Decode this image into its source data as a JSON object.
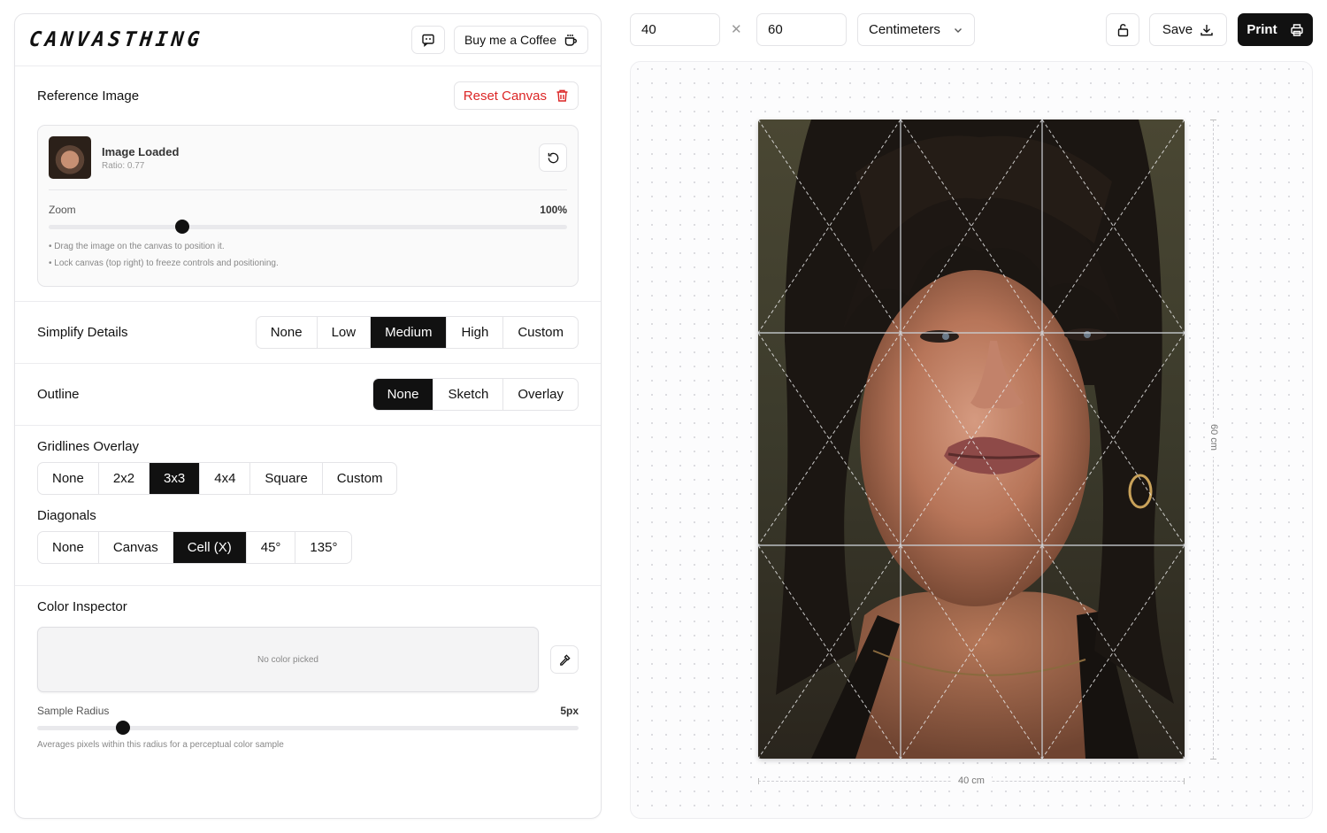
{
  "app": {
    "logo": "CANVASTHING",
    "coffee_label": "Buy me a Coffee"
  },
  "reference": {
    "title": "Reference Image",
    "reset_label": "Reset Canvas",
    "status": "Image Loaded",
    "ratio": "Ratio: 0.77",
    "zoom_label": "Zoom",
    "zoom_value": "100%",
    "zoom_level": 0.25,
    "hint_1": "• Drag the image on the canvas to position it.",
    "hint_2": "• Lock canvas (top right) to freeze controls and positioning."
  },
  "simplify": {
    "label": "Simplify Details",
    "options": [
      "None",
      "Low",
      "Medium",
      "High",
      "Custom"
    ],
    "selected": "Medium"
  },
  "outline": {
    "label": "Outline",
    "options": [
      "None",
      "Sketch",
      "Overlay"
    ],
    "selected": "None"
  },
  "gridlines": {
    "label": "Gridlines Overlay",
    "options": [
      "None",
      "2x2",
      "3x3",
      "4x4",
      "Square",
      "Custom"
    ],
    "selected": "3x3"
  },
  "diagonals": {
    "label": "Diagonals",
    "options": [
      "None",
      "Canvas",
      "Cell (X)",
      "45°",
      "135°"
    ],
    "selected": "Cell (X)"
  },
  "color_inspector": {
    "label": "Color Inspector",
    "empty_text": "No color picked",
    "radius_label": "Sample Radius",
    "radius_value": "5px",
    "radius_level": 0.15,
    "note": "Averages pixels within this radius for a perceptual color sample"
  },
  "toolbar": {
    "width": "40",
    "height": "60",
    "unit": "Centimeters",
    "save_label": "Save",
    "print_label": "Print"
  },
  "canvas": {
    "width_label": "40 cm",
    "height_label": "60 cm"
  },
  "colors": {
    "accent": "#111111",
    "danger": "#dc2626"
  }
}
